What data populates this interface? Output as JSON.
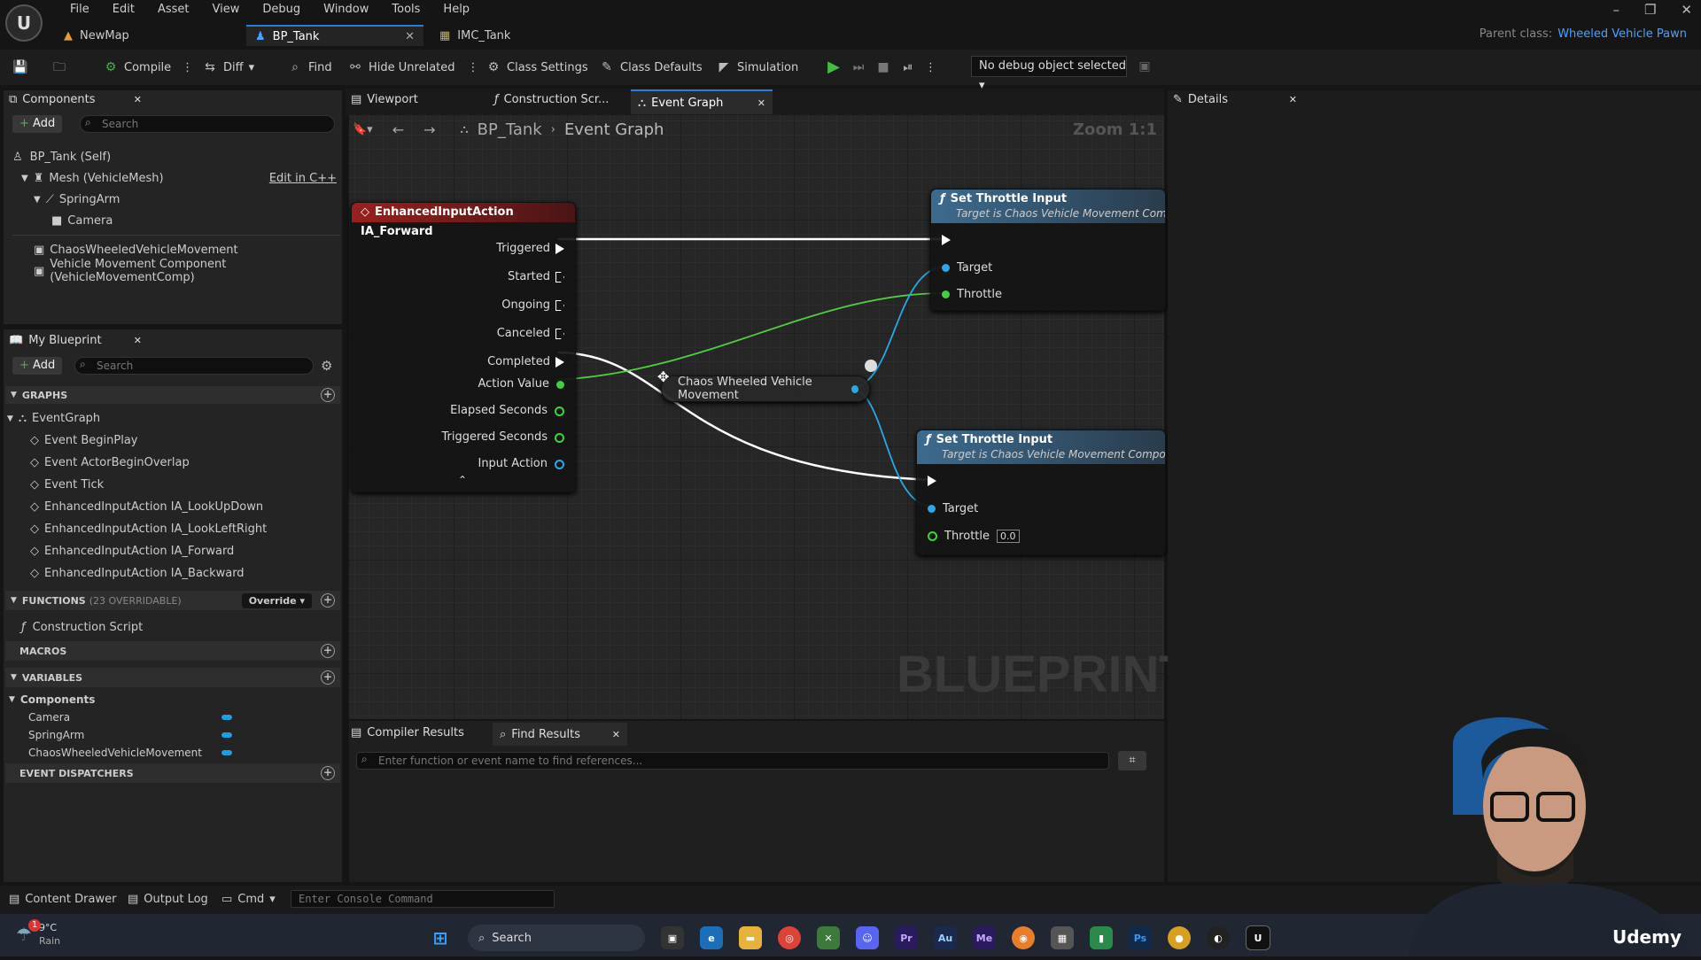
{
  "menu": [
    "File",
    "Edit",
    "Asset",
    "View",
    "Debug",
    "Window",
    "Tools",
    "Help"
  ],
  "tabs": [
    {
      "label": "NewMap",
      "icon": "map-icon"
    },
    {
      "label": "BP_Tank",
      "icon": "blueprint-icon"
    },
    {
      "label": "IMC_Tank",
      "icon": "mapping-context-icon"
    }
  ],
  "parent_class": {
    "label": "Parent class:",
    "value": "Wheeled Vehicle Pawn"
  },
  "toolbar": {
    "compile": "Compile",
    "diff": "Diff",
    "find": "Find",
    "hide_unrelated": "Hide Unrelated",
    "class_settings": "Class Settings",
    "class_defaults": "Class Defaults",
    "simulation": "Simulation",
    "debug_select": "No debug object selected"
  },
  "components_panel": {
    "title": "Components",
    "add": "Add",
    "search_placeholder": "Search",
    "edit_cpp": "Edit in C++",
    "items": [
      "BP_Tank (Self)",
      "Mesh (VehicleMesh)",
      "SpringArm",
      "Camera",
      "ChaosWheeledVehicleMovement",
      "Vehicle Movement Component (VehicleMovementComp)"
    ]
  },
  "my_blueprint": {
    "title": "My Blueprint",
    "add": "Add",
    "search_placeholder": "Search",
    "graphs_label": "GRAPHS",
    "event_graph": "EventGraph",
    "events": [
      "Event BeginPlay",
      "Event ActorBeginOverlap",
      "Event Tick",
      "EnhancedInputAction IA_LookUpDown",
      "EnhancedInputAction IA_LookLeftRight",
      "EnhancedInputAction IA_Forward",
      "EnhancedInputAction IA_Backward"
    ],
    "functions_label": "FUNCTIONS",
    "functions_count": "(23 OVERRIDABLE)",
    "override": "Override",
    "construction_script": "Construction Script",
    "macros_label": "MACROS",
    "variables_label": "VARIABLES",
    "components_label": "Components",
    "variables": [
      "Camera",
      "SpringArm",
      "ChaosWheeledVehicleMovement"
    ],
    "dispatchers_label": "EVENT DISPATCHERS"
  },
  "graph_tabs": [
    "Viewport",
    "Construction Scr...",
    "Event Graph"
  ],
  "breadcrumb": {
    "root": "BP_Tank",
    "current": "Event Graph"
  },
  "zoom": "Zoom 1:1",
  "watermark": "BLUEPRINT",
  "nodes": {
    "input": {
      "title": "EnhancedInputAction IA_Forward",
      "pins": [
        "Triggered",
        "Started",
        "Ongoing",
        "Canceled",
        "Completed",
        "Action Value",
        "Elapsed Seconds",
        "Triggered Seconds",
        "Input Action"
      ]
    },
    "getter": {
      "label": "Chaos Wheeled Vehicle Movement"
    },
    "set1": {
      "title": "Set Throttle Input",
      "subtitle": "Target is Chaos Vehicle Movement Compon",
      "target": "Target",
      "throttle": "Throttle"
    },
    "set2": {
      "title": "Set Throttle Input",
      "subtitle": "Target is Chaos Vehicle Movement Componen",
      "target": "Target",
      "throttle": "Throttle",
      "throttle_value": "0.0"
    }
  },
  "bottom_panel": {
    "compiler": "Compiler Results",
    "find": "Find Results",
    "find_placeholder": "Enter function or event name to find references..."
  },
  "details_panel": {
    "title": "Details"
  },
  "statusbar": {
    "content_drawer": "Content Drawer",
    "output_log": "Output Log",
    "cmd": "Cmd",
    "console_placeholder": "Enter Console Command"
  },
  "taskbar": {
    "weather_temp": "9°C",
    "weather_desc": "Rain",
    "search": "Search",
    "notification_count": "1",
    "watermark": "Udemy"
  }
}
